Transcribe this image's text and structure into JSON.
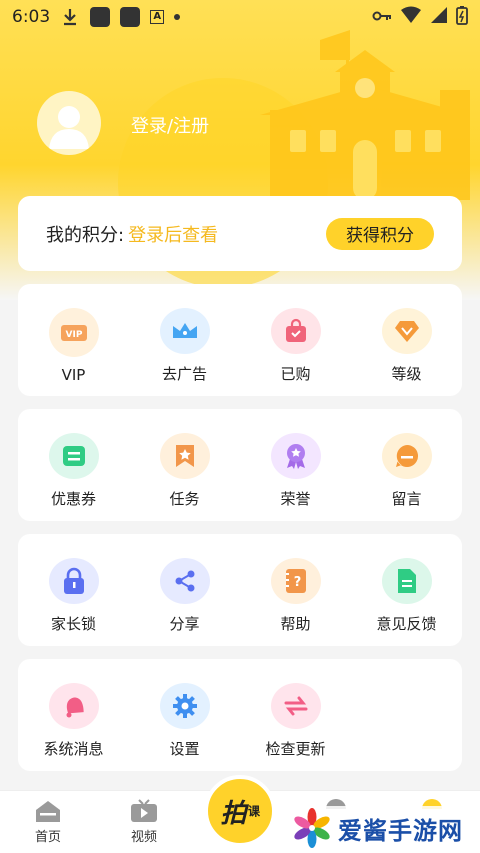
{
  "status_bar": {
    "time": "6:03",
    "notification_letter": "A"
  },
  "profile": {
    "login_label": "登录/注册"
  },
  "points": {
    "label": "我的积分:",
    "value": "登录后查看",
    "earn_button": "获得积分"
  },
  "grid_rows": [
    [
      {
        "label": "VIP",
        "icon": "vip-icon",
        "icon_text": "VIP"
      },
      {
        "label": "去广告",
        "icon": "crown-icon"
      },
      {
        "label": "已购",
        "icon": "shopping-bag-icon"
      },
      {
        "label": "等级",
        "icon": "diamond-icon"
      }
    ],
    [
      {
        "label": "优惠券",
        "icon": "coupon-icon"
      },
      {
        "label": "任务",
        "icon": "bookmark-star-icon"
      },
      {
        "label": "荣誉",
        "icon": "medal-icon"
      },
      {
        "label": "留言",
        "icon": "message-icon"
      }
    ],
    [
      {
        "label": "家长锁",
        "icon": "lock-icon"
      },
      {
        "label": "分享",
        "icon": "share-icon"
      },
      {
        "label": "帮助",
        "icon": "help-book-icon",
        "icon_text": "?"
      },
      {
        "label": "意见反馈",
        "icon": "feedback-doc-icon"
      }
    ],
    [
      {
        "label": "系统消息",
        "icon": "bell-icon"
      },
      {
        "label": "设置",
        "icon": "gear-icon"
      },
      {
        "label": "检查更新",
        "icon": "refresh-arrows-icon"
      }
    ]
  ],
  "bottom_nav": {
    "home_label": "首页",
    "video_label": "视频",
    "center_main": "拍",
    "center_sub": "课"
  },
  "watermark": {
    "text": "爱酱手游网"
  },
  "colors": {
    "accent_yellow": "#ffd22a",
    "points_value": "#f5b91f",
    "watermark_blue": "#1b4fa8"
  }
}
